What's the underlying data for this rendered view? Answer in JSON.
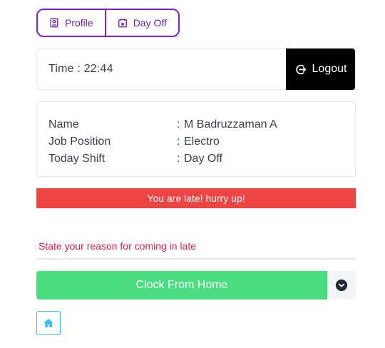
{
  "tabs": [
    {
      "label": "Profile",
      "icon": "profile-icon"
    },
    {
      "label": "Day Off",
      "icon": "calendar-x-icon"
    }
  ],
  "time": {
    "label": "Time : 22:44"
  },
  "logout": {
    "label": "Logout",
    "icon": "logout-icon"
  },
  "info": {
    "rows": [
      {
        "key": "Name",
        "sep": ":",
        "value": "M Badruzzaman A"
      },
      {
        "key": "Job Position",
        "sep": ":",
        "value": "Electro"
      },
      {
        "key": "Today Shift",
        "sep": ":",
        "value": "Day Off"
      }
    ]
  },
  "alert": {
    "text": "You are late! hurry up!"
  },
  "reason": {
    "placeholder": "State your reason for coming in late",
    "value": ""
  },
  "clock": {
    "label": "Clock From Home",
    "toggle_icon": "chevron-down-circle-icon"
  },
  "home": {
    "icon": "home-icon"
  },
  "colors": {
    "accent": "#7e22ce",
    "alert": "#ef4444",
    "clock_button": "#4ade80",
    "logout_bg": "#000000",
    "reason_text": "#e11d48",
    "home_border": "#38bdf8"
  }
}
